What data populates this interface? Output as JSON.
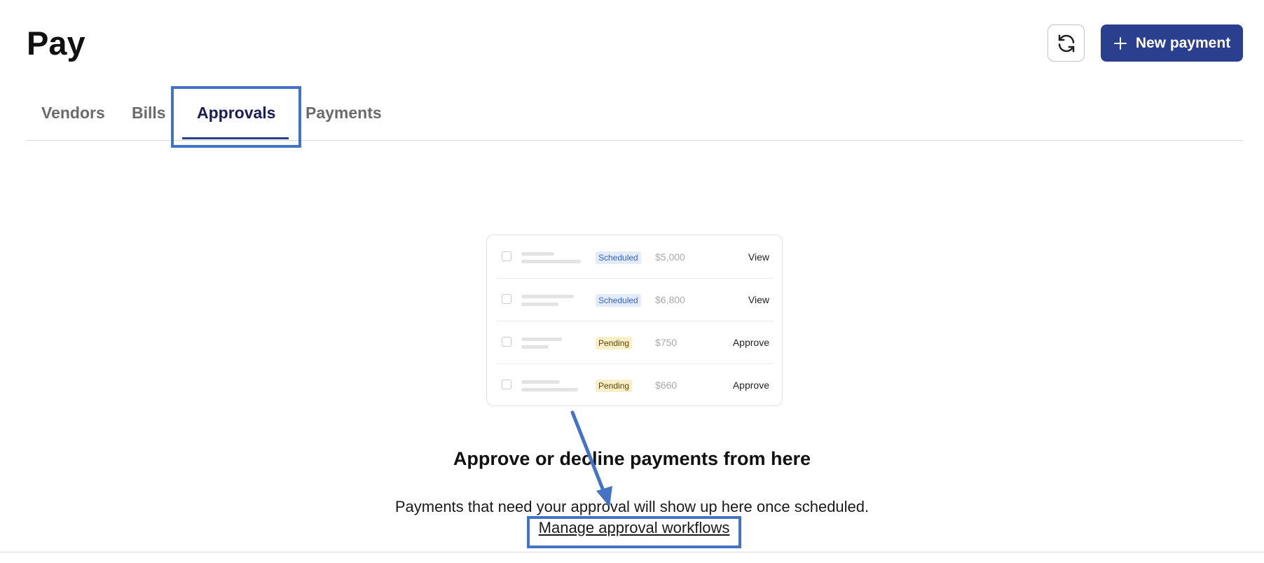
{
  "header": {
    "title": "Pay",
    "refresh_icon": "refresh-icon",
    "new_payment_label": "New payment",
    "plus_icon": "plus-icon"
  },
  "tabs": [
    {
      "label": "Vendors",
      "active": false
    },
    {
      "label": "Bills",
      "active": false
    },
    {
      "label": "Approvals",
      "active": true
    },
    {
      "label": "Payments",
      "active": false
    }
  ],
  "illustration": {
    "rows": [
      {
        "status": "Scheduled",
        "amount": "$5,000",
        "action": "View"
      },
      {
        "status": "Scheduled",
        "amount": "$6,800",
        "action": "View"
      },
      {
        "status": "Pending",
        "amount": "$750",
        "action": "Approve"
      },
      {
        "status": "Pending",
        "amount": "$660",
        "action": "Approve"
      }
    ]
  },
  "empty_state": {
    "title": "Approve or decline payments from here",
    "description": "Payments that need your approval will show up here once scheduled.",
    "link_label": "Manage approval workflows"
  },
  "colors": {
    "primary": "#2b3f8f",
    "annotation": "#4472c4",
    "scheduled_badge_bg": "#e3ecfc",
    "pending_badge_bg": "#fbefc9"
  }
}
